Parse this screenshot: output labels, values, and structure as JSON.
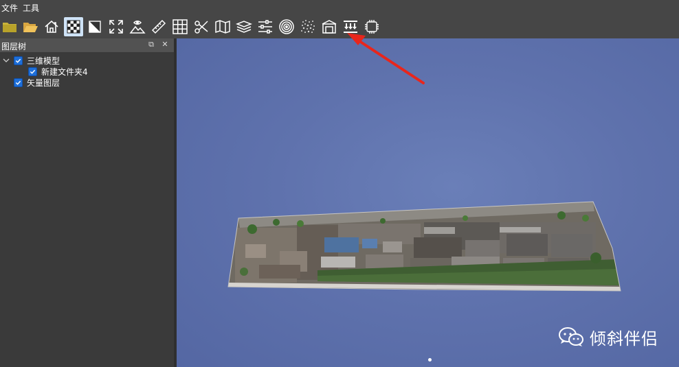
{
  "menu": {
    "file": "文件",
    "tools": "工具"
  },
  "toolbar": {
    "icons": [
      "folder-icon",
      "open-folder-icon",
      "home-icon",
      "checker-icon",
      "diagonal-square-icon",
      "fullscreen-icon",
      "terrain-eye-icon",
      "ruler-icon",
      "grid-icon",
      "scissors-icon",
      "map-icon",
      "layers-icon",
      "sliders-icon",
      "target-icon",
      "noise-icon",
      "building-icon",
      "elevation-icon",
      "cube-icon"
    ],
    "active_index": 3
  },
  "layer_panel": {
    "title": "图层树",
    "items": [
      {
        "label": "三维模型",
        "level": 0,
        "expanded": true,
        "checked": true
      },
      {
        "label": "新建文件夹4",
        "level": 1,
        "checked": true
      },
      {
        "label": "矢量图层",
        "level": 0,
        "checked": true
      }
    ]
  },
  "watermark": {
    "text": "倾斜伴侣"
  },
  "colors": {
    "annotation_arrow": "#e8261c",
    "checkbox": "#1e6fd9",
    "viewport_bg": "#5f72ad"
  }
}
